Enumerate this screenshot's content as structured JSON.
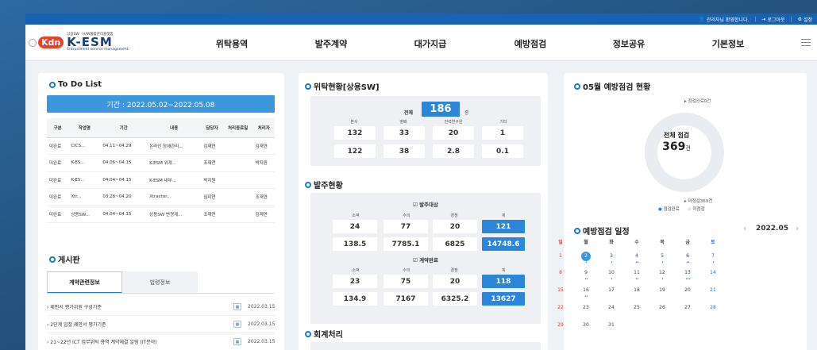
{
  "topbar": {
    "user_text": "관리자님 환영합니다.",
    "logout": "로그아웃",
    "settings": "설정"
  },
  "logo": {
    "small": "상용SW · H/W통합관리플랫폼",
    "name": "K-ESM",
    "sub": "Entrustment service management",
    "kdn": "Kdn"
  },
  "nav": [
    "위탁용역",
    "발주계약",
    "대가지급",
    "예방점검",
    "정보공유",
    "기본정보"
  ],
  "todo": {
    "title": "To Do List",
    "period": "기간 : 2022.05.02~2022.05.08",
    "headers": [
      "구분",
      "작업명",
      "기간",
      "내용",
      "담당자",
      "처리종료일",
      "처리자"
    ],
    "rows": [
      [
        "미완료",
        "CICS...",
        "04.11~04.29",
        "온라인 장애관리...",
        "김재연",
        "",
        "김재연"
      ],
      [
        "미완료",
        "K-ES...",
        "04.06~04.15",
        "K-ESM 위계...",
        "조재연",
        "",
        "박지원"
      ],
      [
        "미완료",
        "K-ES...",
        "04.04~04.15",
        "K-ESM 내부...",
        "박지원",
        "",
        ""
      ],
      [
        "미완료",
        "Xtr...",
        "03.28~04.20",
        "Xtractor...",
        "임미연",
        "",
        "조재연"
      ],
      [
        "미완료",
        "상용SW...",
        "04.04~04.15",
        "상용SW 변경계...",
        "조재연",
        "",
        "김재연"
      ]
    ]
  },
  "board": {
    "title": "게시판",
    "tabs": [
      "계약관련정보",
      "법령정보"
    ],
    "posts": [
      {
        "title": "› 제안서 평가위원 구성기준",
        "date": "2022.03.15"
      },
      {
        "title": "› 2단계 입찰 제안서 평가기준",
        "date": "2022.03.15"
      },
      {
        "title": "› 21~22년 ICT 업무위탁 용역 계약체결 알림 (IT분야)",
        "date": "2022.03.15"
      }
    ]
  },
  "entrust": {
    "title": "위탁현황[상용SW]",
    "total_label": "전체",
    "total": "186",
    "total_unit": "종",
    "labels": [
      "본사",
      "영배",
      "전력연구원",
      "기타"
    ],
    "row1": [
      "132",
      "33",
      "20",
      "1"
    ],
    "row2": [
      "122",
      "38",
      "2.8",
      "0.1"
    ]
  },
  "order": {
    "title": "발주현황",
    "target_label": "☑ 발주대상",
    "done_label": "☑ 계약완료",
    "labels": [
      "소액",
      "수의",
      "경쟁",
      "계"
    ],
    "t1": [
      "24",
      "77",
      "20",
      "121"
    ],
    "t2": [
      "138.5",
      "7785.1",
      "6825",
      "14748.6"
    ],
    "d1": [
      "23",
      "75",
      "20",
      "118"
    ],
    "d2": [
      "134.9",
      "7167",
      "6325.2",
      "13627"
    ]
  },
  "accounting": {
    "title": "회계처리"
  },
  "inspect": {
    "title": "05월 예방점검 현황",
    "done_note": "점검완료0건",
    "undone_note": "미점검369건",
    "center_label": "전체 점검",
    "center_value": "369",
    "center_unit": "건",
    "legend": [
      "점검완료",
      "미점검"
    ]
  },
  "schedule": {
    "title": "예방점검 일정",
    "month": "2022.05",
    "prev": "‹",
    "next": "›",
    "weekdays": [
      "일",
      "월",
      "화",
      "수",
      "목",
      "금",
      "토"
    ],
    "weeks": [
      [
        "1",
        "2",
        "3",
        "4",
        "5",
        "6",
        "7"
      ],
      [
        "8",
        "9",
        "10",
        "11",
        "12",
        "13",
        "14"
      ],
      [
        "15",
        "16",
        "17",
        "18",
        "19",
        "20",
        "21"
      ],
      [
        "22",
        "23",
        "24",
        "25",
        "26",
        "27",
        "28"
      ],
      [
        "29",
        "30",
        "31",
        "",
        "",
        "",
        ""
      ]
    ]
  },
  "colors": {
    "primary": "#1a79d0",
    "accent": "#2b86da",
    "topbar": "#1762b4",
    "logo_red": "#e4462d"
  }
}
